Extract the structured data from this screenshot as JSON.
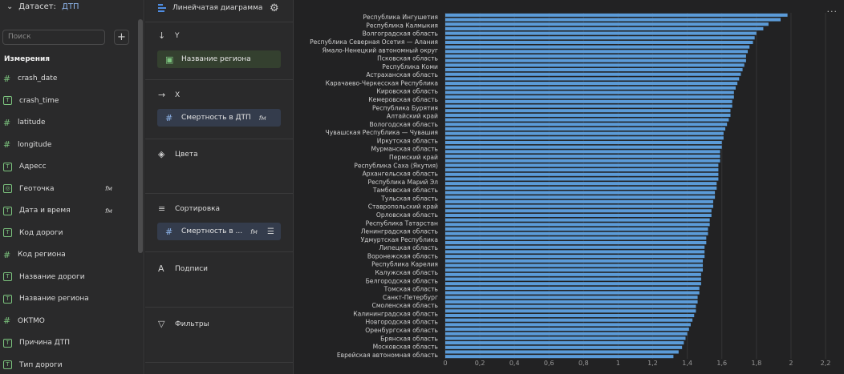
{
  "dataset": {
    "label": "Датасет:",
    "name": "ДТП"
  },
  "search": {
    "placeholder": "Поиск"
  },
  "add_label": "+",
  "section_title": "Измерения",
  "fields": [
    {
      "label": "crash_date",
      "icon": "number-icon",
      "fx": ""
    },
    {
      "label": "crash_time",
      "icon": "text-type-icon",
      "fx": ""
    },
    {
      "label": "latitude",
      "icon": "number-icon",
      "fx": ""
    },
    {
      "label": "longitude",
      "icon": "number-icon",
      "fx": ""
    },
    {
      "label": "Адресс",
      "icon": "text-type-icon",
      "fx": ""
    },
    {
      "label": "Геоточка",
      "icon": "geo-type-icon",
      "fx": "fм"
    },
    {
      "label": "Дата и время",
      "icon": "text-type-icon",
      "fx": "fм"
    },
    {
      "label": "Код дороги",
      "icon": "text-type-icon",
      "fx": ""
    },
    {
      "label": "Код региона",
      "icon": "number-icon",
      "fx": ""
    },
    {
      "label": "Название дороги",
      "icon": "text-type-icon",
      "fx": ""
    },
    {
      "label": "Название региона",
      "icon": "text-type-icon",
      "fx": ""
    },
    {
      "label": "ОКТМО",
      "icon": "number-icon",
      "fx": ""
    },
    {
      "label": "Причина ДТП",
      "icon": "text-type-icon",
      "fx": ""
    },
    {
      "label": "Тип дороги",
      "icon": "text-type-icon",
      "fx": ""
    }
  ],
  "visualization": {
    "type_label": "Линейчатая диаграмма"
  },
  "sections": {
    "y": {
      "label": "Y",
      "chip": "Название региона"
    },
    "x": {
      "label": "X",
      "chip": "Смертность в ДТП",
      "fx": "fм"
    },
    "colors": {
      "label": "Цвета"
    },
    "sort": {
      "label": "Сортировка",
      "chip": "Смертность в ...",
      "fx": "fм"
    },
    "labels": {
      "label": "Подписи"
    },
    "filters": {
      "label": "Фильтры"
    }
  },
  "more_label": "···",
  "colors": {
    "bar": "#5b9bd8",
    "accent": "#8fb7ee",
    "green": "#7cc47e"
  },
  "chart_data": {
    "type": "bar",
    "orientation": "horizontal",
    "xlim": [
      0,
      2.2
    ],
    "xticks": [
      "0",
      "0,2",
      "0,4",
      "0,6",
      "0,8",
      "1",
      "1,2",
      "1,4",
      "1,6",
      "1,8",
      "2",
      "2,2"
    ],
    "grid": true,
    "labeled_categories": [
      "Республика Ингушетия",
      "Республика Калмыкия",
      "Волгоградская область",
      "Республика Северная Осетия — Алания",
      "Ямало-Ненецкий автономный округ",
      "Псковская область",
      "Республика Коми",
      "Астраханская область",
      "Карачаево-Черкесская Республика",
      "Кировская область",
      "Кемеровская область",
      "Республика Бурятия",
      "Алтайский край",
      "Вологодская область",
      "Чувашская Республика — Чувашия",
      "Иркутская область",
      "Мурманская область",
      "Пермский край",
      "Республика Саха (Якутия)",
      "Архангельская область",
      "Республика Марий Эл",
      "Тамбовская область",
      "Тульская область",
      "Ставропольский край",
      "Орловская область",
      "Республика Татарстан",
      "Ленинградская область",
      "Удмуртская Республика",
      "Липецкая область",
      "Воронежская область",
      "Республика Карелия",
      "Калужская область",
      "Белгородская область",
      "Томская область",
      "Санкт-Петербург",
      "Смоленская область",
      "Калининградская область",
      "Новгородская область",
      "Оренбургская область",
      "Брянская область",
      "Московская область",
      "Еврейская автономная область"
    ],
    "values": [
      1.98,
      1.94,
      1.87,
      1.84,
      1.8,
      1.79,
      1.78,
      1.76,
      1.75,
      1.74,
      1.74,
      1.73,
      1.72,
      1.71,
      1.7,
      1.69,
      1.68,
      1.67,
      1.67,
      1.66,
      1.66,
      1.65,
      1.65,
      1.64,
      1.63,
      1.62,
      1.61,
      1.61,
      1.6,
      1.6,
      1.59,
      1.59,
      1.59,
      1.58,
      1.58,
      1.58,
      1.58,
      1.57,
      1.57,
      1.56,
      1.56,
      1.55,
      1.55,
      1.54,
      1.54,
      1.53,
      1.53,
      1.52,
      1.52,
      1.51,
      1.51,
      1.5,
      1.5,
      1.5,
      1.49,
      1.49,
      1.49,
      1.48,
      1.48,
      1.48,
      1.47,
      1.47,
      1.46,
      1.46,
      1.45,
      1.45,
      1.44,
      1.43,
      1.42,
      1.41,
      1.4,
      1.39,
      1.38,
      1.37,
      1.35,
      1.32
    ]
  }
}
